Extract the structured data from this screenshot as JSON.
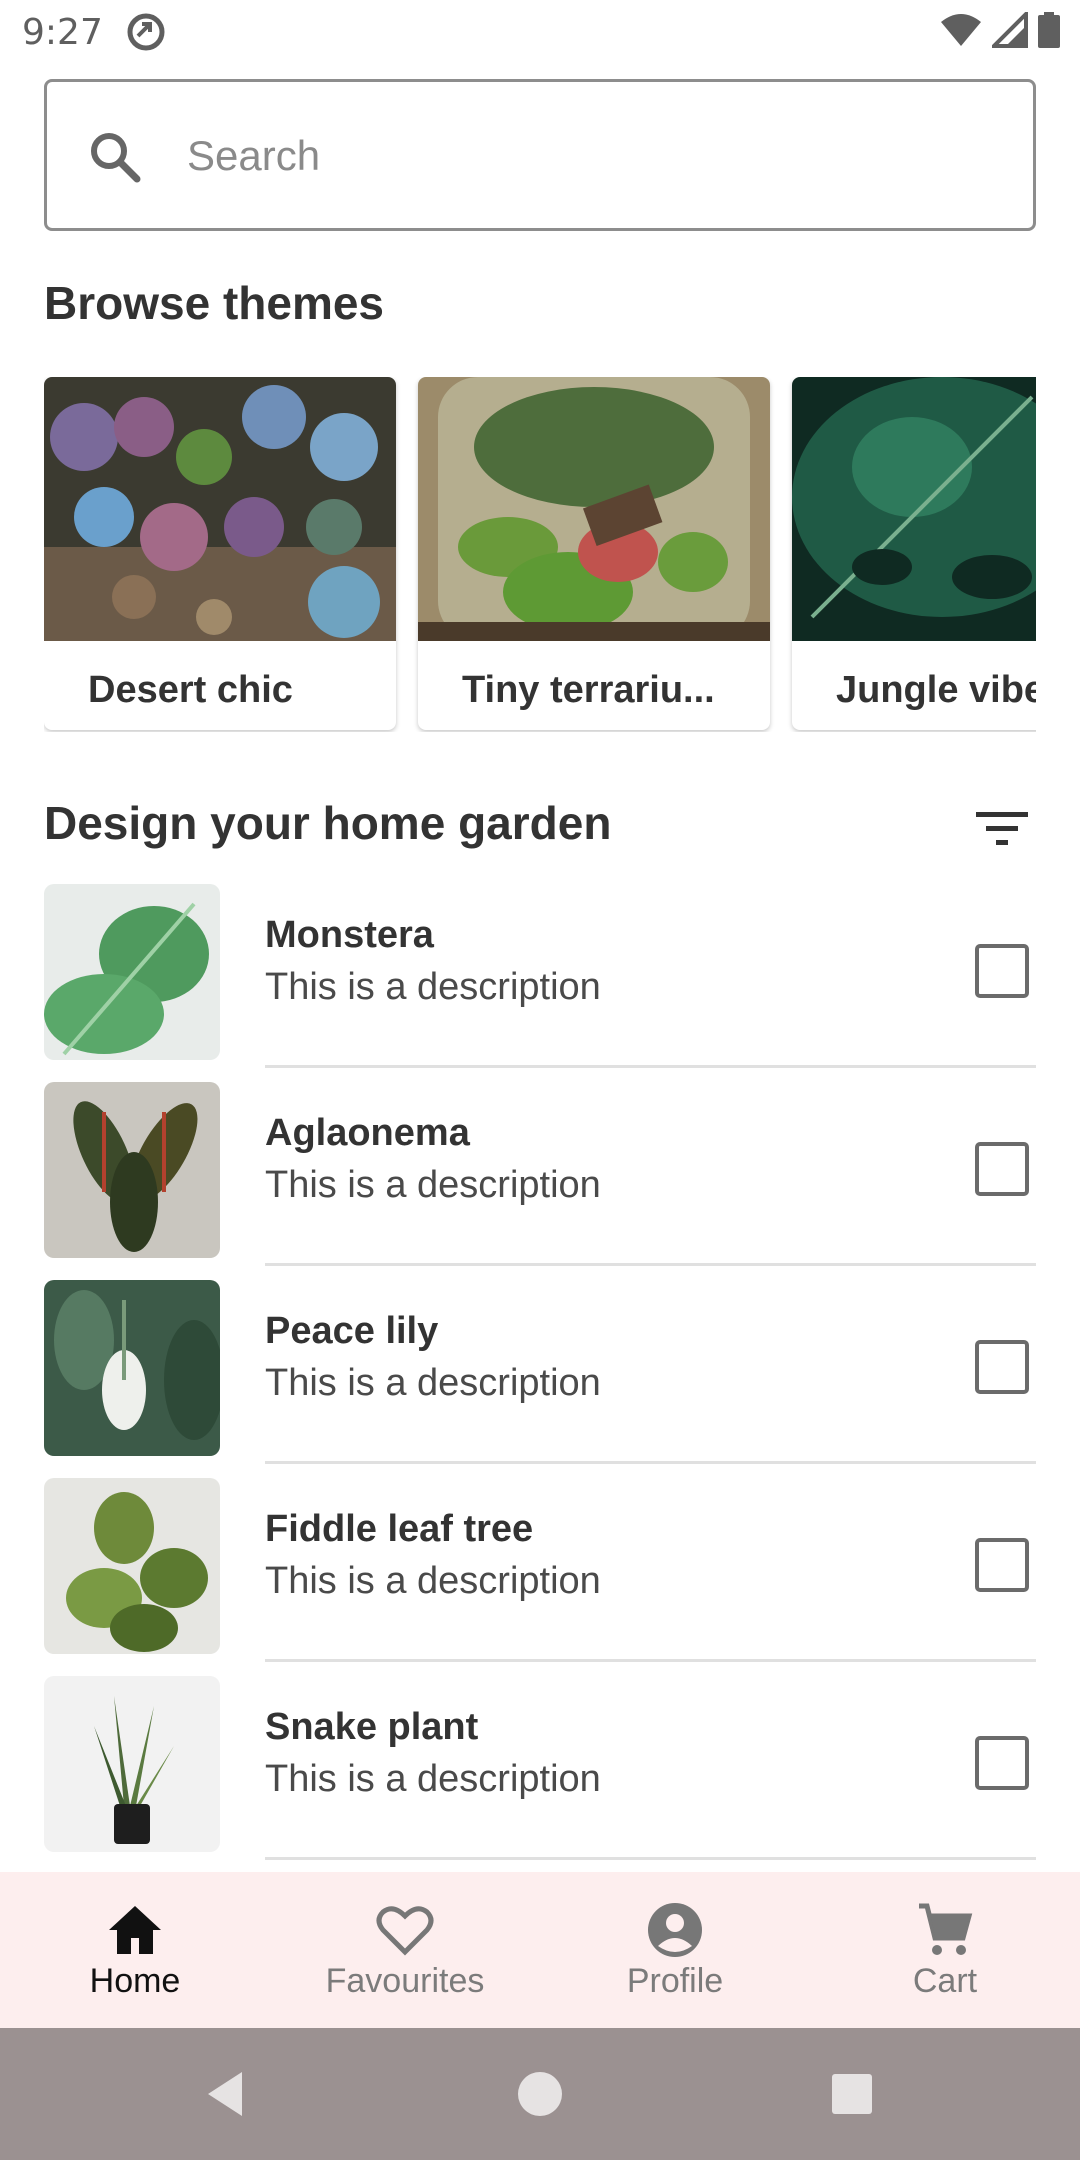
{
  "status_bar": {
    "time": "9:27",
    "icons": [
      "data-saver-icon",
      "wifi-icon",
      "signal-icon",
      "battery-icon"
    ]
  },
  "search": {
    "placeholder": "Search",
    "icon": "search-icon"
  },
  "browse": {
    "title": "Browse themes",
    "themes": [
      {
        "label": "Desert chic"
      },
      {
        "label": "Tiny terrariu..."
      },
      {
        "label": "Jungle vibes"
      }
    ]
  },
  "garden": {
    "title": "Design your home garden",
    "filter_icon": "filter-icon",
    "plants": [
      {
        "name": "Monstera",
        "description": "This is a description",
        "checked": false
      },
      {
        "name": "Aglaonema",
        "description": "This is a description",
        "checked": false
      },
      {
        "name": "Peace lily",
        "description": "This is a description",
        "checked": false
      },
      {
        "name": "Fiddle leaf tree",
        "description": "This is a description",
        "checked": false
      },
      {
        "name": "Snake plant",
        "description": "This is a description",
        "checked": false
      }
    ]
  },
  "bottom_nav": {
    "items": [
      {
        "label": "Home",
        "icon": "home-icon",
        "active": true
      },
      {
        "label": "Favourites",
        "icon": "heart-icon",
        "active": false
      },
      {
        "label": "Profile",
        "icon": "account-circle-icon",
        "active": false
      },
      {
        "label": "Cart",
        "icon": "cart-icon",
        "active": false
      }
    ]
  },
  "colors": {
    "nav_background": "#fdeeee",
    "system_nav_background": "#9b9191",
    "text_primary": "#333333"
  }
}
